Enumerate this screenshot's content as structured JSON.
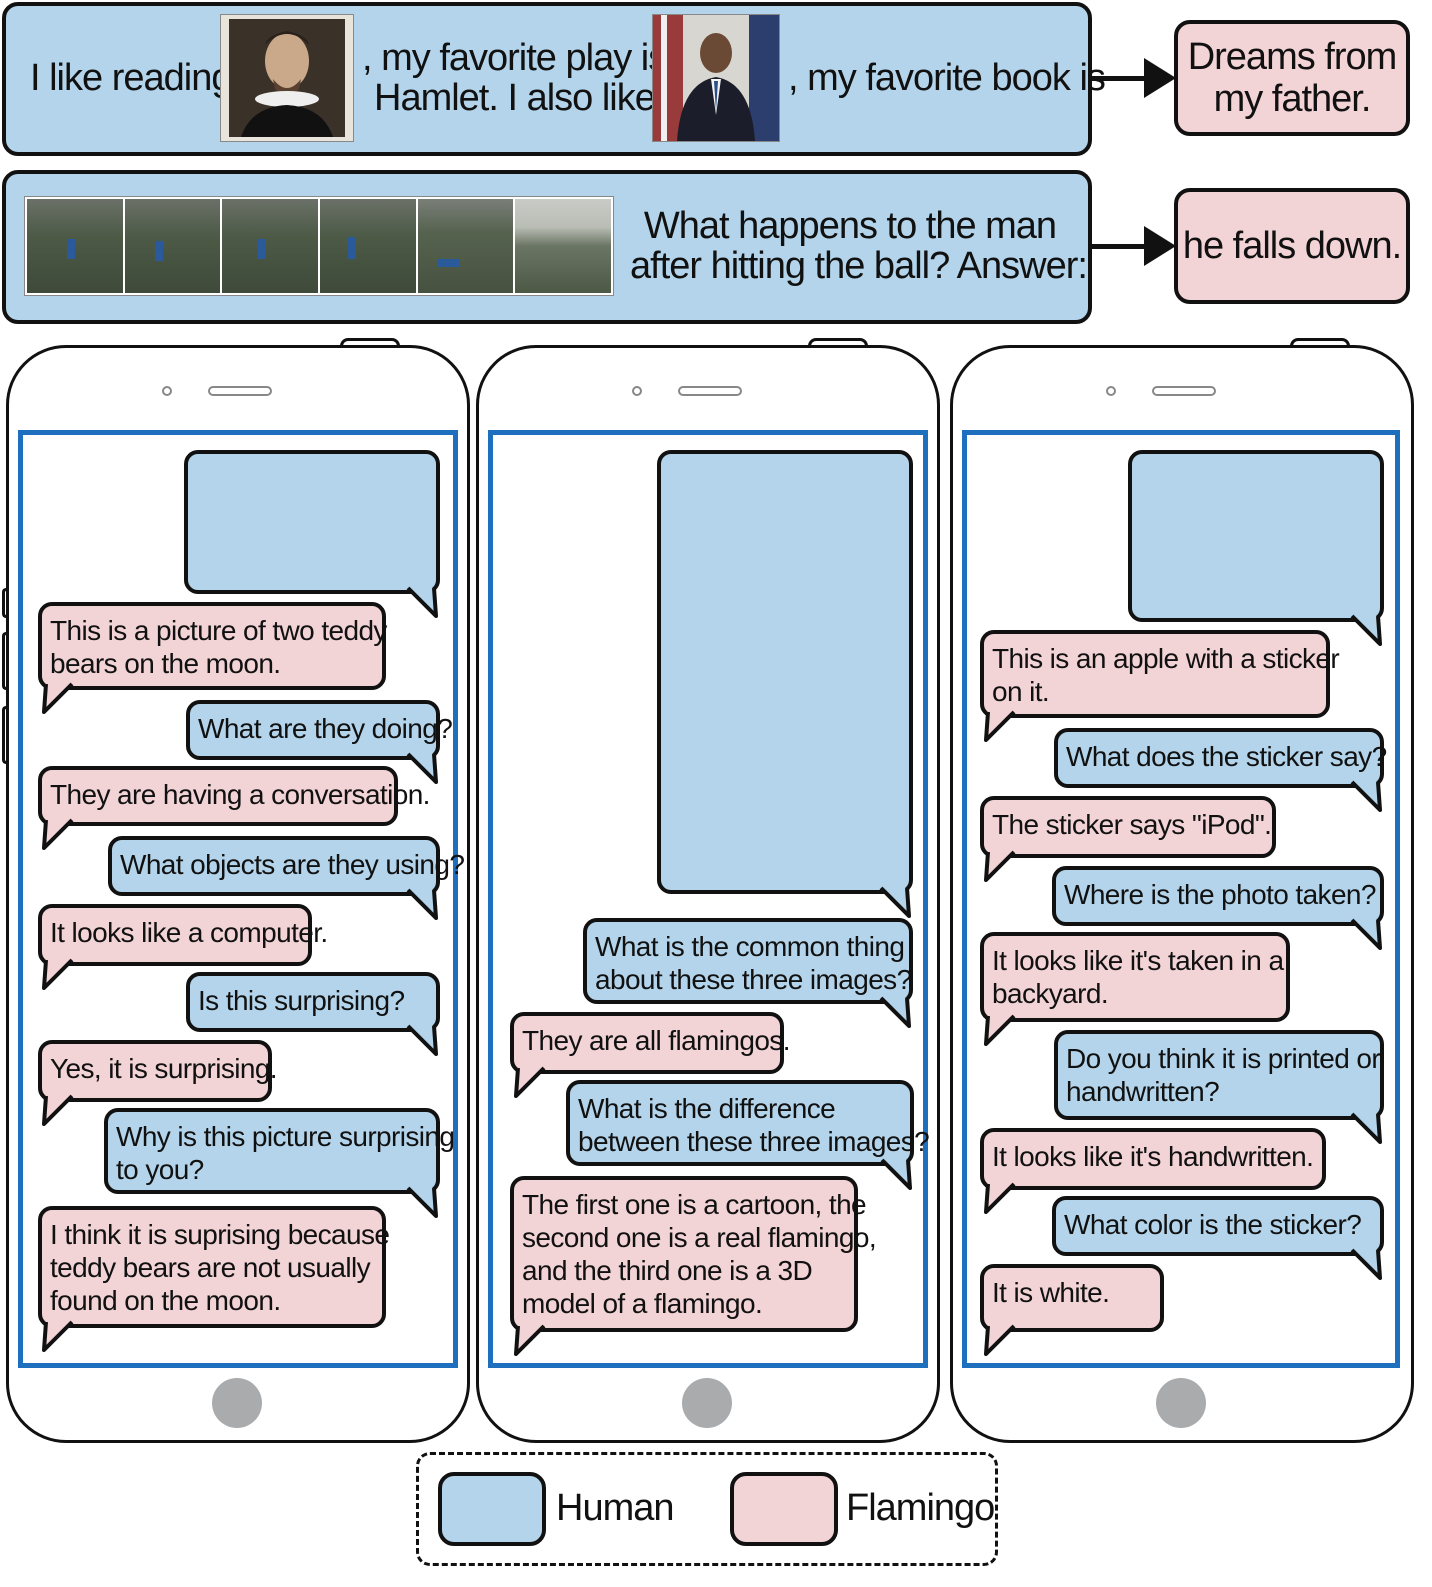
{
  "prompts": {
    "row1": {
      "text1": "I like reading",
      "text2_line1": ", my favorite play is",
      "text2_line2": "Hamlet. I also like",
      "text3": ", my favorite book is",
      "output_line1": "Dreams from",
      "output_line2": "my father."
    },
    "row2": {
      "question_line1": "What happens to the man",
      "question_line2": "after hitting the ball? Answer:",
      "output": "he falls down."
    }
  },
  "phones": [
    {
      "messages": [
        {
          "role": "flamingo",
          "lines": [
            "This is a picture of two teddy",
            "bears on the moon."
          ]
        },
        {
          "role": "human",
          "lines": [
            "What are they doing?"
          ]
        },
        {
          "role": "flamingo",
          "lines": [
            "They are having a conversation."
          ]
        },
        {
          "role": "human",
          "lines": [
            "What objects are they using?"
          ]
        },
        {
          "role": "flamingo",
          "lines": [
            "It looks like a computer."
          ]
        },
        {
          "role": "human",
          "lines": [
            "Is this surprising?"
          ]
        },
        {
          "role": "flamingo",
          "lines": [
            "Yes, it is surprising."
          ]
        },
        {
          "role": "human",
          "lines": [
            "Why is this picture surprising",
            "to you?"
          ]
        },
        {
          "role": "flamingo",
          "lines": [
            "I think it is suprising because",
            "teddy bears are not usually",
            "found on the moon."
          ]
        }
      ]
    },
    {
      "messages": [
        {
          "role": "human",
          "lines": [
            "What is the common thing",
            "about these three images?"
          ]
        },
        {
          "role": "flamingo",
          "lines": [
            "They are all flamingos."
          ]
        },
        {
          "role": "human",
          "lines": [
            "What is the difference",
            "between these three images?"
          ]
        },
        {
          "role": "flamingo",
          "lines": [
            "The first one is a cartoon, the",
            "second one is a real flamingo,",
            "and the third one is a 3D",
            "model of a flamingo."
          ]
        }
      ]
    },
    {
      "ipod_sticker_text": "iPod",
      "messages": [
        {
          "role": "flamingo",
          "lines": [
            "This is an apple with a sticker",
            "on it."
          ]
        },
        {
          "role": "human",
          "lines": [
            "What does the sticker say?"
          ]
        },
        {
          "role": "flamingo",
          "lines": [
            "The sticker says \"iPod\"."
          ]
        },
        {
          "role": "human",
          "lines": [
            "Where is the photo taken?"
          ]
        },
        {
          "role": "flamingo",
          "lines": [
            "It looks like it's taken in a",
            "backyard."
          ]
        },
        {
          "role": "human",
          "lines": [
            "Do you think it is printed or",
            "handwritten?"
          ]
        },
        {
          "role": "flamingo",
          "lines": [
            "It looks like it's handwritten."
          ]
        },
        {
          "role": "human",
          "lines": [
            "What color is the sticker?"
          ]
        },
        {
          "role": "flamingo",
          "lines": [
            "It is white."
          ]
        }
      ]
    }
  ],
  "legend": {
    "human_label": "Human",
    "flamingo_label": "Flamingo"
  },
  "colors": {
    "human": "#b3d4ea",
    "flamingo": "#f2d3d6",
    "screen_border": "#1f6fbf",
    "home_button": "#a9abad"
  }
}
